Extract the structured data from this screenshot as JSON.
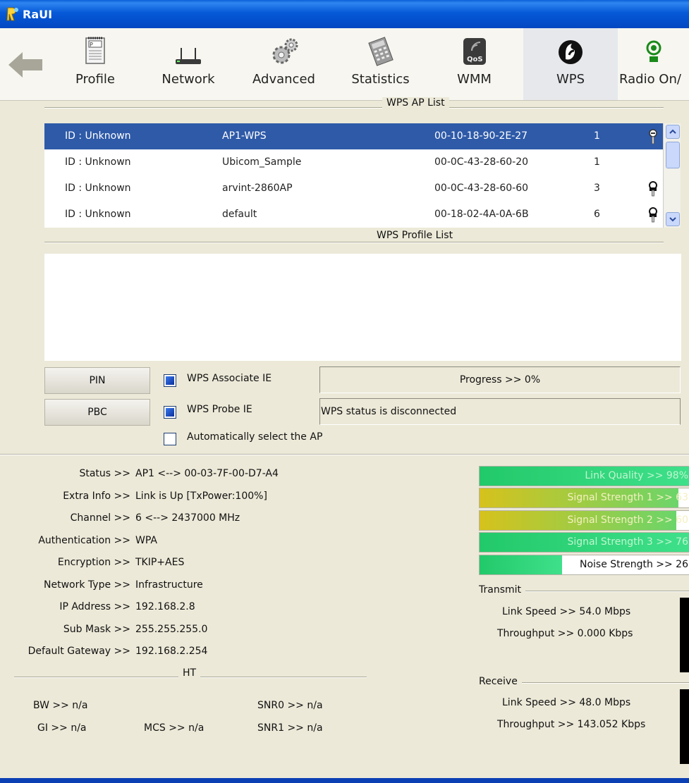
{
  "window": {
    "title": "RaUI"
  },
  "toolbar": {
    "items": [
      {
        "label": "Profile"
      },
      {
        "label": "Network"
      },
      {
        "label": "Advanced"
      },
      {
        "label": "Statistics"
      },
      {
        "label": "WMM"
      },
      {
        "label": "WPS"
      },
      {
        "label": "Radio On/"
      }
    ],
    "qos_badge": "QoS"
  },
  "wps_ap_list": {
    "title": "WPS AP List",
    "rows": [
      {
        "id": "ID : Unknown",
        "ssid": "AP1-WPS",
        "bssid": "00-10-18-90-2E-27",
        "channel": "1",
        "key": true,
        "selected": true
      },
      {
        "id": "ID : Unknown",
        "ssid": "Ubicom_Sample",
        "bssid": "00-0C-43-28-60-20",
        "channel": "1",
        "key": false,
        "selected": false
      },
      {
        "id": "ID : Unknown",
        "ssid": "arvint-2860AP",
        "bssid": "00-0C-43-28-60-60",
        "channel": "3",
        "key": true,
        "selected": false
      },
      {
        "id": "ID : Unknown",
        "ssid": "default",
        "bssid": "00-18-02-4A-0A-6B",
        "channel": "6",
        "key": true,
        "selected": false
      }
    ]
  },
  "wps_profile_list": {
    "title": "WPS Profile List"
  },
  "controls": {
    "pin_label": "PIN",
    "pbc_label": "PBC",
    "assoc_ie_label": "WPS Associate IE",
    "probe_ie_label": "WPS Probe IE",
    "auto_select_label": "Automatically select the AP",
    "assoc_ie_checked": true,
    "probe_ie_checked": true,
    "auto_select_checked": false,
    "progress_text": "Progress >> 0%",
    "progress_value": 0,
    "status_text": "WPS status is disconnected"
  },
  "status": {
    "rows": [
      {
        "label": "Status >>",
        "value": "AP1 <--> 00-03-7F-00-D7-A4"
      },
      {
        "label": "Extra Info >>",
        "value": "Link is Up [TxPower:100%]"
      },
      {
        "label": "Channel >>",
        "value": "6 <--> 2437000 MHz"
      },
      {
        "label": "Authentication >>",
        "value": "WPA"
      },
      {
        "label": "Encryption >>",
        "value": "TKIP+AES"
      },
      {
        "label": "Network Type >>",
        "value": "Infrastructure"
      },
      {
        "label": "IP Address >>",
        "value": "192.168.2.8"
      },
      {
        "label": "Sub Mask >>",
        "value": "255.255.255.0"
      },
      {
        "label": "Default Gateway >>",
        "value": "192.168.2.254"
      }
    ],
    "ht_title": "HT",
    "ht": {
      "bw": "BW >> n/a",
      "gi": "GI >> n/a",
      "mcs": "MCS >> n/a",
      "snr0": "SNR0 >> n/a",
      "snr1": "SNR1 >> n/a"
    }
  },
  "signal": {
    "bars": [
      {
        "text": "Link Quality >> 98%",
        "level": 1.0,
        "color_start": "#22c96a",
        "color_end": "#3fe08a",
        "text_color": "#bff5cf"
      },
      {
        "text": "Signal Strength 1 >> 63",
        "level": 0.94,
        "color_start": "#d6c21c",
        "color_end": "#6bd56a",
        "text_color": "#f4f0c0"
      },
      {
        "text": "Signal Strength 2 >> 60",
        "level": 0.93,
        "color_start": "#d6c21c",
        "color_end": "#6bd56a",
        "text_color": "#f4f0c0"
      },
      {
        "text": "Signal Strength 3 >> 76",
        "level": 1.0,
        "color_start": "#22c96a",
        "color_end": "#3fe08a",
        "text_color": "#bff5cf"
      },
      {
        "text": "Noise Strength >> 26",
        "level": 0.39,
        "color_start": "#22c96a",
        "color_end": "#3fe08a",
        "text_color": "#111111"
      }
    ],
    "transmit": {
      "title": "Transmit",
      "link_speed": "Link Speed >> 54.0 Mbps",
      "throughput": "Throughput >> 0.000 Kbps"
    },
    "receive": {
      "title": "Receive",
      "link_speed": "Link Speed >> 48.0 Mbps",
      "throughput": "Throughput >> 143.052 Kbps"
    }
  }
}
